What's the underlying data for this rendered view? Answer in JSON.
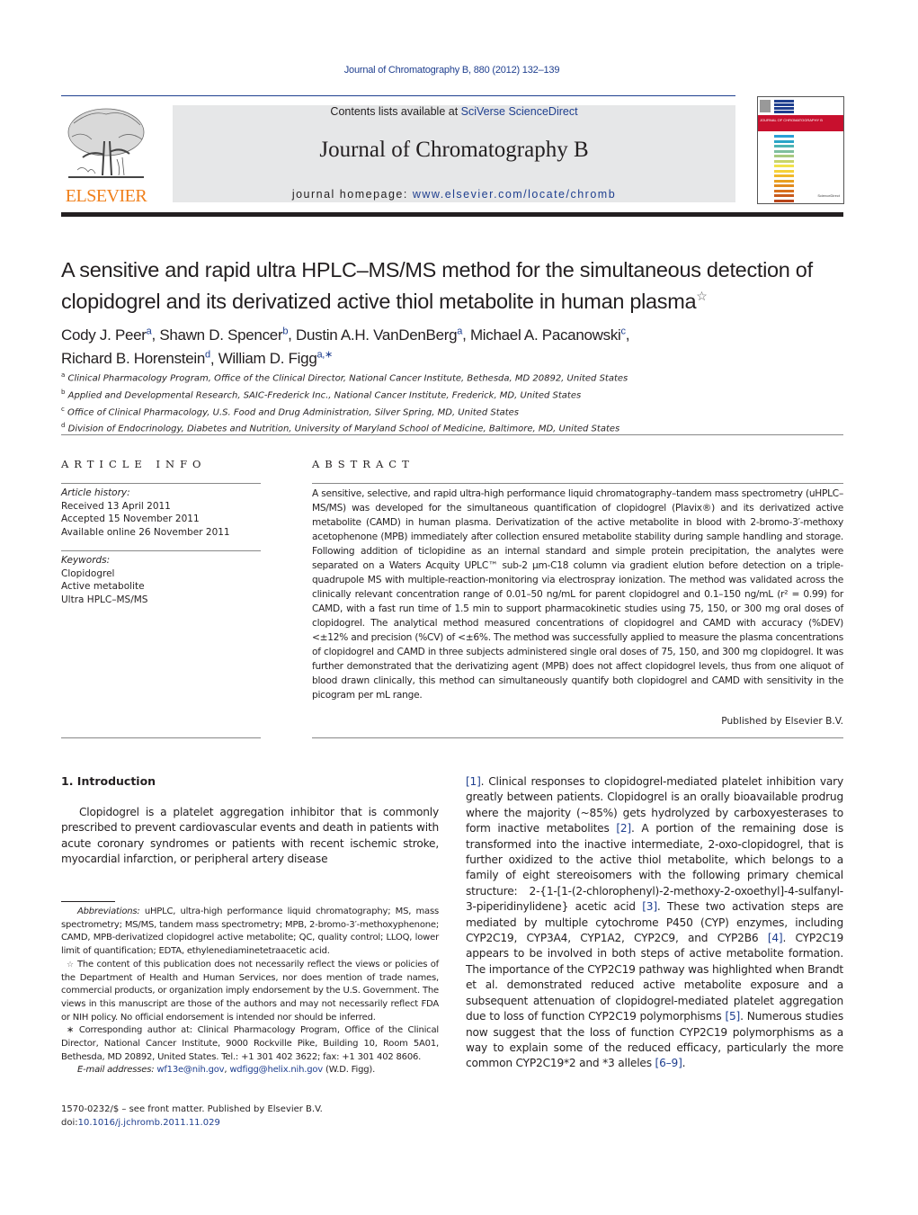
{
  "header": {
    "running_head": "Journal of Chromatography B, 880 (2012) 132–139",
    "publisher_logo_text": "ELSEVIER",
    "contents_prefix": "Contents lists available at ",
    "contents_link": "SciVerse ScienceDirect",
    "journal_title": "Journal of Chromatography B",
    "homepage_prefix": "journal homepage: ",
    "homepage_link": "www.elsevier.com/locate/chromb",
    "cover_title": "JOURNAL OF CHROMATOGRAPHY B",
    "cover_badge": "ScienceDirect",
    "brand_colors": {
      "elsevier_orange": "#f07f1a",
      "link_blue": "#1f3f8f",
      "cover_red": "#c8102e",
      "banner_gray": "#e6e7e8"
    }
  },
  "article": {
    "title": "A sensitive and rapid ultra HPLC–MS/MS method for the simultaneous detection of clopidogrel and its derivatized active thiol metabolite in human plasma",
    "title_note_mark": "☆",
    "authors": [
      {
        "name": "Cody J. Peer",
        "sup": "a"
      },
      {
        "name": "Shawn D. Spencer",
        "sup": "b"
      },
      {
        "name": "Dustin A.H. VanDenBerg",
        "sup": "a"
      },
      {
        "name": "Michael A. Pacanowski",
        "sup": "c"
      },
      {
        "name": "Richard B. Horenstein",
        "sup": "d"
      },
      {
        "name": "William D. Figg",
        "sup": "a,∗"
      }
    ],
    "affiliations": [
      {
        "mark": "a",
        "text": "Clinical Pharmacology Program, Office of the Clinical Director, National Cancer Institute, Bethesda, MD 20892, United States"
      },
      {
        "mark": "b",
        "text": "Applied and Developmental Research, SAIC-Frederick Inc., National Cancer Institute, Frederick, MD, United States"
      },
      {
        "mark": "c",
        "text": "Office of Clinical Pharmacology, U.S. Food and Drug Administration, Silver Spring, MD, United States"
      },
      {
        "mark": "d",
        "text": "Division of Endocrinology, Diabetes and Nutrition, University of Maryland School of Medicine, Baltimore, MD, United States"
      }
    ]
  },
  "article_info": {
    "heading": "ARTICLE INFO",
    "history_label": "Article history:",
    "history": [
      "Received 13 April 2011",
      "Accepted 15 November 2011",
      "Available online 26 November 2011"
    ],
    "keywords_label": "Keywords:",
    "keywords": [
      "Clopidogrel",
      "Active metabolite",
      "Ultra HPLC–MS/MS"
    ]
  },
  "abstract": {
    "heading": "ABSTRACT",
    "text": "A sensitive, selective, and rapid ultra-high performance liquid chromatography–tandem mass spectrometry (uHPLC–MS/MS) was developed for the simultaneous quantification of clopidogrel (Plavix®) and its derivatized active metabolite (CAMD) in human plasma. Derivatization of the active metabolite in blood with 2-bromo-3′-methoxy acetophenone (MPB) immediately after collection ensured metabolite stability during sample handling and storage. Following addition of ticlopidine as an internal standard and simple protein precipitation, the analytes were separated on a Waters Acquity UPLC™ sub-2 µm-C18 column via gradient elution before detection on a triple-quadrupole MS with multiple-reaction-monitoring via electrospray ionization. The method was validated across the clinically relevant concentration range of 0.01–50 ng/mL for parent clopidogrel and 0.1–150 ng/mL (r² = 0.99) for CAMD, with a fast run time of 1.5 min to support pharmacokinetic studies using 75, 150, or 300 mg oral doses of clopidogrel. The analytical method measured concentrations of clopidogrel and CAMD with accuracy (%DEV) <±12% and precision (%CV) of <±6%. The method was successfully applied to measure the plasma concentrations of clopidogrel and CAMD in three subjects administered single oral doses of 75, 150, and 300 mg clopidogrel. It was further demonstrated that the derivatizing agent (MPB) does not affect clopidogrel levels, thus from one aliquot of blood drawn clinically, this method can simultaneously quantify both clopidogrel and CAMD with sensitivity in the picogram per mL range.",
    "published_by": "Published by Elsevier B.V."
  },
  "introduction": {
    "heading": "1.  Introduction",
    "p1": "Clopidogrel is a platelet aggregation inhibitor that is commonly prescribed to prevent cardiovascular events and death in patients with acute coronary syndromes or patients with recent ischemic stroke, myocardial infarction, or peripheral artery disease",
    "col2_segments": [
      {
        "t": "[1]",
        "ref": true
      },
      {
        "t": ". Clinical responses to clopidogrel-mediated platelet inhibition vary greatly between patients. Clopidogrel is an orally bioavailable prodrug where the majority (~85%) gets hydrolyzed by carboxyesterases to form inactive metabolites ",
        "ref": false
      },
      {
        "t": "[2]",
        "ref": true
      },
      {
        "t": ". A portion of the remaining dose is transformed into the inactive intermediate, 2-oxo-clopidogrel, that is further oxidized to the active thiol metabolite, which belongs to a family of eight stereoisomers with the following primary chemical structure: 2-{1-[1-(2-chlorophenyl)-2-methoxy-2-oxoethyl]-4-sulfanyl-3-piperidinylidene} acetic acid ",
        "ref": false
      },
      {
        "t": "[3]",
        "ref": true
      },
      {
        "t": ". These two activation steps are mediated by multiple cytochrome P450 (CYP) enzymes, including CYP2C19, CYP3A4, CYP1A2, CYP2C9, and CYP2B6 ",
        "ref": false
      },
      {
        "t": "[4]",
        "ref": true
      },
      {
        "t": ". CYP2C19 appears to be involved in both steps of active metabolite formation. The importance of the CYP2C19 pathway was highlighted when Brandt et al. demonstrated reduced active metabolite exposure and a subsequent attenuation of clopidogrel-mediated platelet aggregation due to loss of function CYP2C19 polymorphisms ",
        "ref": false
      },
      {
        "t": "[5]",
        "ref": true
      },
      {
        "t": ". Numerous studies now suggest that the loss of function CYP2C19 polymorphisms as a way to explain some of the reduced efficacy, particularly the more common CYP2C19*2 and *3 alleles ",
        "ref": false
      },
      {
        "t": "[6–9]",
        "ref": true
      },
      {
        "t": ".",
        "ref": false
      }
    ]
  },
  "footnotes": {
    "abbrev_label": "Abbreviations:",
    "abbrev_text": " uHPLC, ultra-high performance liquid chromatography; MS, mass spectrometry; MS/MS, tandem mass spectrometry; MPB, 2-bromo-3′-methoxyphenone; CAMD, MPB-derivatized clopidogrel active metabolite; QC, quality control; LLOQ, lower limit of quantification; EDTA, ethylenediaminetetraacetic acid.",
    "disclaimer_mark": "☆",
    "disclaimer": " The content of this publication does not necessarily reflect the views or policies of the Department of Health and Human Services, nor does mention of trade names, commercial products, or organization imply endorsement by the U.S. Government. The views in this manuscript are those of the authors and may not necessarily reflect FDA or NIH policy. No official endorsement is intended nor should be inferred.",
    "corresponding_mark": "∗",
    "corresponding": " Corresponding author at: Clinical Pharmacology Program, Office of the Clinical Director, National Cancer Institute, 9000 Rockville Pike, Building 10, Room 5A01, Bethesda, MD 20892, United States. Tel.: +1 301 402 3622; fax: +1 301 402 8606.",
    "email_label": "E-mail addresses:",
    "email_1": "wf13e@nih.gov",
    "email_sep": ", ",
    "email_2": "wdfigg@helix.nih.gov",
    "email_suffix": " (W.D. Figg)."
  },
  "footer": {
    "issn_line": "1570-0232/$ – see front matter. Published by Elsevier B.V.",
    "doi_prefix": "doi:",
    "doi_link": "10.1016/j.jchromb.2011.11.029"
  }
}
